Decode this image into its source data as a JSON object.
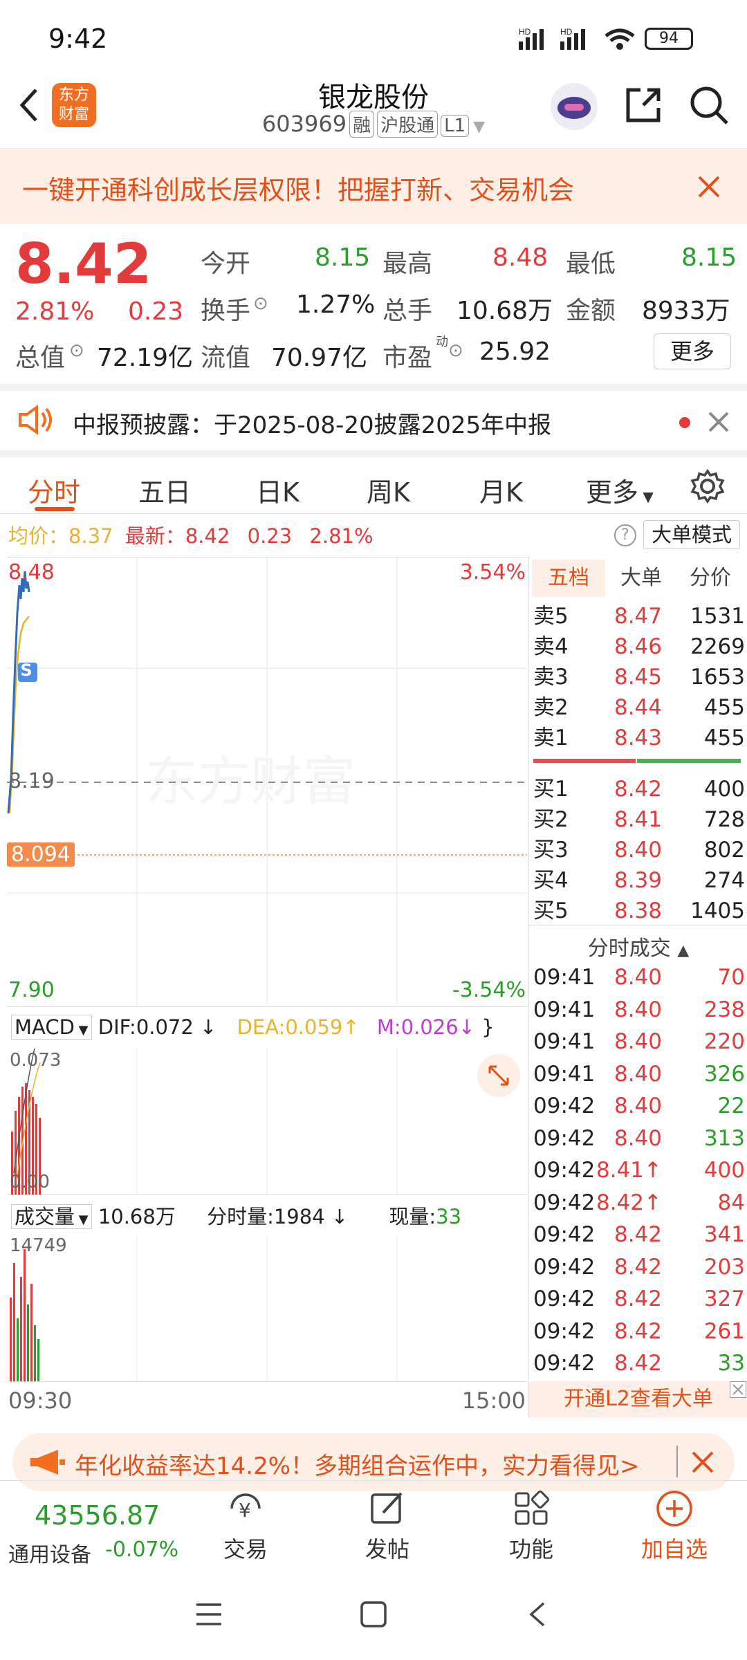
{
  "status_bar": {
    "time": "9:42",
    "battery": "94"
  },
  "header": {
    "title": "银龙股份",
    "code": "603969",
    "tags": [
      "融",
      "沪股通",
      "L1"
    ],
    "logo_text": "东方财富"
  },
  "banner": {
    "text": "一键开通科创成长层权限！把握打新、交易机会"
  },
  "quote": {
    "price": "8.42",
    "change_pct": "2.81%",
    "change": "0.23",
    "open_label": "今开",
    "open": "8.15",
    "high_label": "最高",
    "high": "8.48",
    "low_label": "最低",
    "low": "8.15",
    "turnover_label": "换手",
    "turnover": "1.27%",
    "volume_label": "总手",
    "volume": "10.68万",
    "amount_label": "金额",
    "amount": "8933万",
    "mcap_label": "总值",
    "mcap": "72.19亿",
    "float_label": "流值",
    "float": "70.97亿",
    "pe_label": "市盈",
    "pe_sup": "动",
    "pe": "25.92",
    "more_button": "更多"
  },
  "notice": {
    "text": "中报预披露：于2025-08-20披露2025年中报"
  },
  "tabs": [
    "分时",
    "五日",
    "日K",
    "周K",
    "月K",
    "更多"
  ],
  "info_line": {
    "avg_label": "均价：",
    "avg": "8.37",
    "latest_label": "最新：",
    "latest": "8.42",
    "change": "0.23",
    "change_pct": "2.81%",
    "mode_button": "大单模式"
  },
  "price_chart": {
    "top_price": "8.48",
    "top_pct": "3.54%",
    "mid_price": "8.19",
    "marker_price": "8.094",
    "bottom_price": "7.90",
    "bottom_pct": "-3.54%",
    "watermark": "东方财富",
    "s_marker": "S"
  },
  "macd": {
    "label": "MACD",
    "dif": "DIF:0.072",
    "dea": "DEA:0.059",
    "m": "M:0.026",
    "top": "0.073",
    "bottom": "0.00"
  },
  "volume_panel": {
    "label": "成交量",
    "total": "10.68万",
    "min_vol": "分时量:1984",
    "now_label": "现量:",
    "now": "33",
    "top": "14749",
    "start_time": "09:30",
    "end_time": "15:00"
  },
  "orderbook": {
    "tabs": [
      "五档",
      "大单",
      "分价"
    ],
    "asks": [
      {
        "label": "卖5",
        "price": "8.47",
        "vol": "1531"
      },
      {
        "label": "卖4",
        "price": "8.46",
        "vol": "2269"
      },
      {
        "label": "卖3",
        "price": "8.45",
        "vol": "1653"
      },
      {
        "label": "卖2",
        "price": "8.44",
        "vol": "455"
      },
      {
        "label": "卖1",
        "price": "8.43",
        "vol": "455"
      }
    ],
    "bids": [
      {
        "label": "买1",
        "price": "8.42",
        "vol": "400"
      },
      {
        "label": "买2",
        "price": "8.41",
        "vol": "728"
      },
      {
        "label": "买3",
        "price": "8.40",
        "vol": "802"
      },
      {
        "label": "买4",
        "price": "8.39",
        "vol": "274"
      },
      {
        "label": "买5",
        "price": "8.38",
        "vol": "1405"
      }
    ],
    "ticks_title": "分时成交",
    "ticks": [
      {
        "time": "09:41",
        "price": "8.40",
        "vol": "70",
        "dir": "red"
      },
      {
        "time": "09:41",
        "price": "8.40",
        "vol": "238",
        "dir": "red"
      },
      {
        "time": "09:41",
        "price": "8.40",
        "vol": "220",
        "dir": "red"
      },
      {
        "time": "09:41",
        "price": "8.40",
        "vol": "326",
        "dir": "green"
      },
      {
        "time": "09:42",
        "price": "8.40",
        "vol": "22",
        "dir": "green"
      },
      {
        "time": "09:42",
        "price": "8.40",
        "vol": "313",
        "dir": "green"
      },
      {
        "time": "09:42",
        "price": "8.41↑",
        "vol": "400",
        "dir": "red"
      },
      {
        "time": "09:42",
        "price": "8.42↑",
        "vol": "84",
        "dir": "red"
      },
      {
        "time": "09:42",
        "price": "8.42",
        "vol": "341",
        "dir": "red"
      },
      {
        "time": "09:42",
        "price": "8.42",
        "vol": "203",
        "dir": "red"
      },
      {
        "time": "09:42",
        "price": "8.42",
        "vol": "327",
        "dir": "red"
      },
      {
        "time": "09:42",
        "price": "8.42",
        "vol": "261",
        "dir": "red"
      },
      {
        "time": "09:42",
        "price": "8.42",
        "vol": "33",
        "dir": "green"
      }
    ],
    "l2_button": "开通L2查看大单"
  },
  "promo": {
    "text": "年化收益率达14.2%！多期组合运作中，实力看得见>"
  },
  "bottom": {
    "index_value": "43556.87",
    "index_name": "通用设备",
    "index_change": "-0.07%",
    "items": [
      "交易",
      "发帖",
      "功能",
      "加自选"
    ]
  },
  "colors": {
    "accent": "#f26f21",
    "up": "#e23b3b",
    "down": "#2a9d2a",
    "avg_line": "#e8b430",
    "price_line": "#2f6db5"
  }
}
